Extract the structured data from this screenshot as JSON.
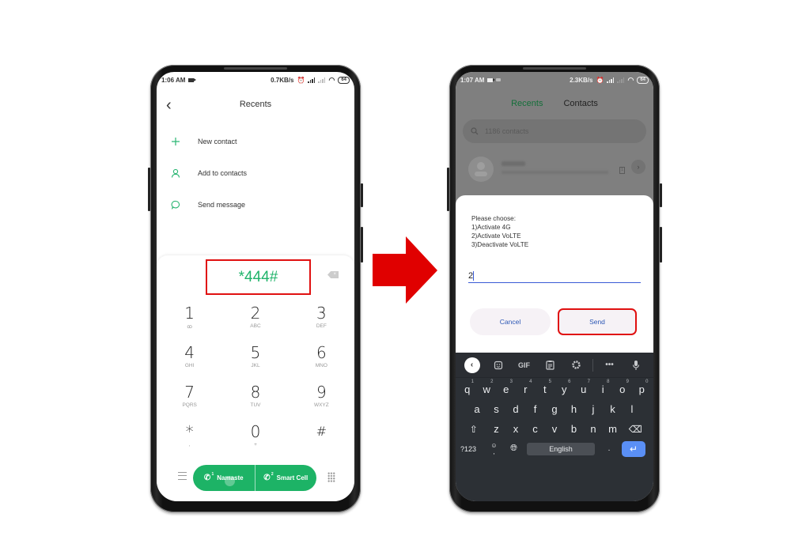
{
  "left_phone": {
    "status": {
      "time": "1:06 AM",
      "speed": "0.7KB/s",
      "battery": "64"
    },
    "header": {
      "title": "Recents"
    },
    "menu": [
      {
        "icon": "plus-icon",
        "label": "New contact"
      },
      {
        "icon": "person-icon",
        "label": "Add to contacts"
      },
      {
        "icon": "message-bubble-icon",
        "label": "Send message"
      }
    ],
    "dialer": {
      "number": "*444#",
      "keys": [
        {
          "digit": "1",
          "sub": "ꝏ"
        },
        {
          "digit": "2",
          "sub": "ABC"
        },
        {
          "digit": "3",
          "sub": "DEF"
        },
        {
          "digit": "4",
          "sub": "GHI"
        },
        {
          "digit": "5",
          "sub": "JKL"
        },
        {
          "digit": "6",
          "sub": "MNO"
        },
        {
          "digit": "7",
          "sub": "PQRS"
        },
        {
          "digit": "8",
          "sub": "TUV"
        },
        {
          "digit": "9",
          "sub": "WXYZ"
        },
        {
          "digit": "*",
          "sub": ","
        },
        {
          "digit": "0",
          "sub": "+"
        },
        {
          "digit": "#",
          "sub": ""
        }
      ],
      "call_sim1": {
        "sim": "1",
        "label": "Namaste"
      },
      "call_sim2": {
        "sim": "2",
        "label": "Smart Cell"
      }
    },
    "highlight_color": "#e01010",
    "accent_color": "#1db366"
  },
  "arrow": {
    "color": "#e00000",
    "direction": "right"
  },
  "right_phone": {
    "status": {
      "time": "1:07 AM",
      "speed": "2.3KB/s",
      "battery": "64"
    },
    "tabs": [
      {
        "label": "Recents",
        "active": true
      },
      {
        "label": "Contacts",
        "active": false
      }
    ],
    "search": {
      "placeholder": "1186 contacts"
    },
    "dialog": {
      "message": "Please choose:\n1)Activate 4G\n2)Activate VoLTE\n3)Deactivate VoLTE",
      "input_value": "2",
      "cancel_label": "Cancel",
      "send_label": "Send"
    },
    "keyboard": {
      "toolbar": [
        "back-icon",
        "sticker-icon",
        "GIF",
        "clipboard-icon",
        "settings-icon",
        "more-icon",
        "mic-icon"
      ],
      "gif_label": "GIF",
      "row1": [
        {
          "k": "q",
          "n": "1"
        },
        {
          "k": "w",
          "n": "2"
        },
        {
          "k": "e",
          "n": "3"
        },
        {
          "k": "r",
          "n": "4"
        },
        {
          "k": "t",
          "n": "5"
        },
        {
          "k": "y",
          "n": "6"
        },
        {
          "k": "u",
          "n": "7"
        },
        {
          "k": "i",
          "n": "8"
        },
        {
          "k": "o",
          "n": "9"
        },
        {
          "k": "p",
          "n": "0"
        }
      ],
      "row2": [
        "a",
        "s",
        "d",
        "f",
        "g",
        "h",
        "j",
        "k",
        "l"
      ],
      "row3": [
        "z",
        "x",
        "c",
        "v",
        "b",
        "n",
        "m"
      ],
      "symbols_label": "?123",
      "comma_label": ",",
      "space_label": "English",
      "period_label": ".",
      "enter_color": "#5a8ff5"
    }
  }
}
